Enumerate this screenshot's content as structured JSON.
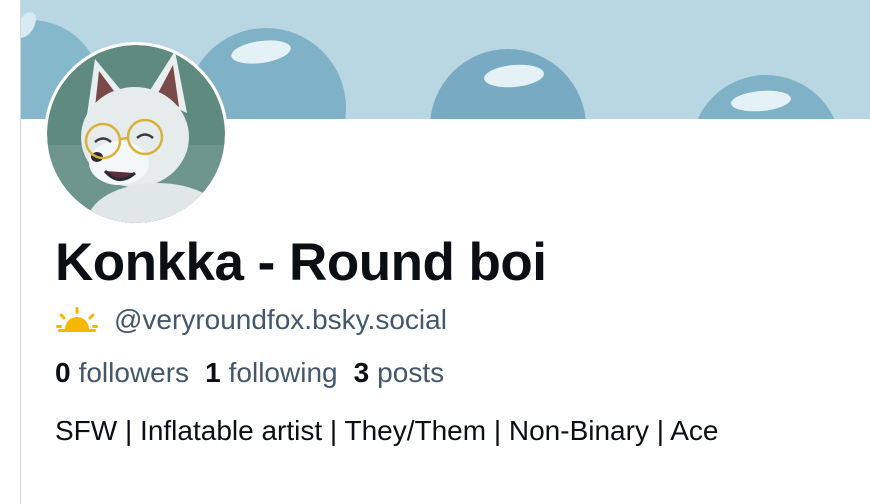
{
  "profile": {
    "display_name": "Konkka - Round boi",
    "handle": "@veryroundfox.bsky.social",
    "handle_icon": "sunrise-icon",
    "bio": "SFW | Inflatable artist | They/Them | Non-Binary | Ace"
  },
  "stats": {
    "followers_count": "0",
    "followers_label": "followers",
    "following_count": "1",
    "following_label": "following",
    "posts_count": "3",
    "posts_label": "posts"
  },
  "colors": {
    "banner_background": "#b9d7e2",
    "banner_bubble": "#7aaec6",
    "text_primary": "#0b0f14",
    "text_secondary": "#42576c",
    "sun_icon": "#f5b800"
  }
}
